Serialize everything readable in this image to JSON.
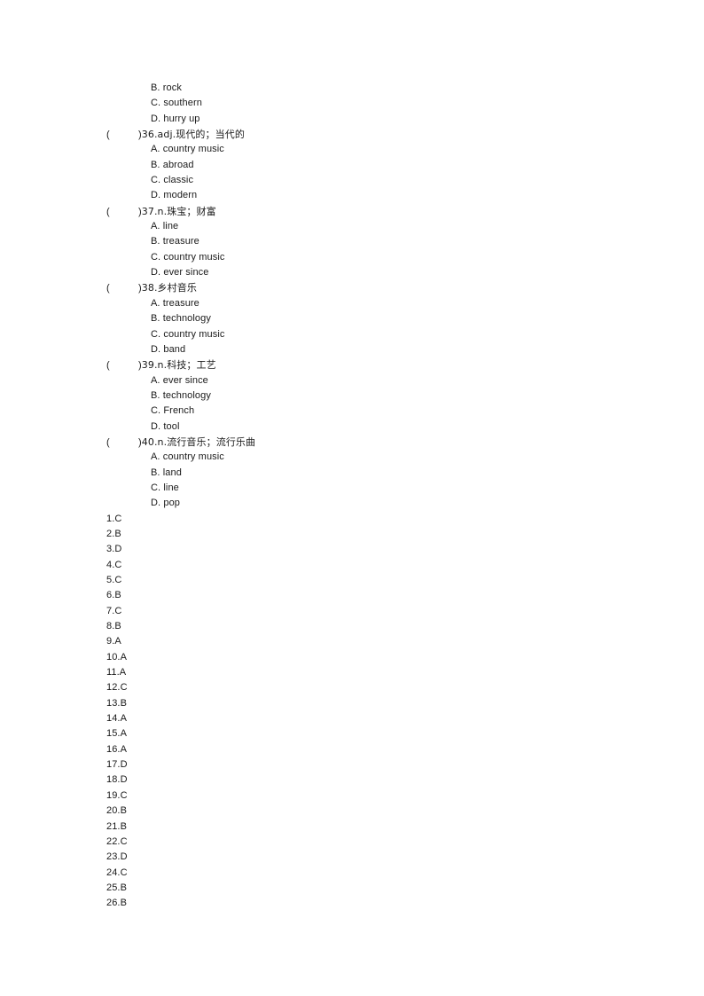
{
  "document": {
    "type": "vocabulary-worksheet",
    "page_background": "#ffffff",
    "text_color": "#1a1a1a"
  },
  "carryover_options": [
    "B. rock",
    "C. southern",
    "D. hurry up"
  ],
  "questions": [
    {
      "paren_open": "(",
      "paren_close": ")",
      "stem": "36.adj.现代的；当代的",
      "options": [
        "A. country music",
        "B. abroad",
        "C. classic",
        "D. modern"
      ]
    },
    {
      "paren_open": "(",
      "paren_close": ")",
      "stem": "37.n.珠宝；财富",
      "options": [
        "A. line",
        "B. treasure",
        "C. country music",
        "D. ever since"
      ]
    },
    {
      "paren_open": "(",
      "paren_close": ")",
      "stem": "38.乡村音乐",
      "options": [
        "A. treasure",
        "B. technology",
        "C. country music",
        "D. band"
      ]
    },
    {
      "paren_open": "(",
      "paren_close": ")",
      "stem": "39.n.科技；工艺",
      "options": [
        "A. ever since",
        "B. technology",
        "C. French",
        "D. tool"
      ]
    },
    {
      "paren_open": "(",
      "paren_close": ")",
      "stem": "40.n.流行音乐；流行乐曲",
      "options": [
        "A. country music",
        "B. land",
        "C. line",
        "D. pop"
      ]
    }
  ],
  "answer_key": [
    "1.C",
    "2.B",
    "3.D",
    "4.C",
    "5.C",
    "6.B",
    "7.C",
    "8.B",
    "9.A",
    "10.A",
    "11.A",
    "12.C",
    "13.B",
    "14.A",
    "15.A",
    "16.A",
    "17.D",
    "18.D",
    "19.C",
    "20.B",
    "21.B",
    "22.C",
    "23.D",
    "24.C",
    "25.B",
    "26.B"
  ]
}
